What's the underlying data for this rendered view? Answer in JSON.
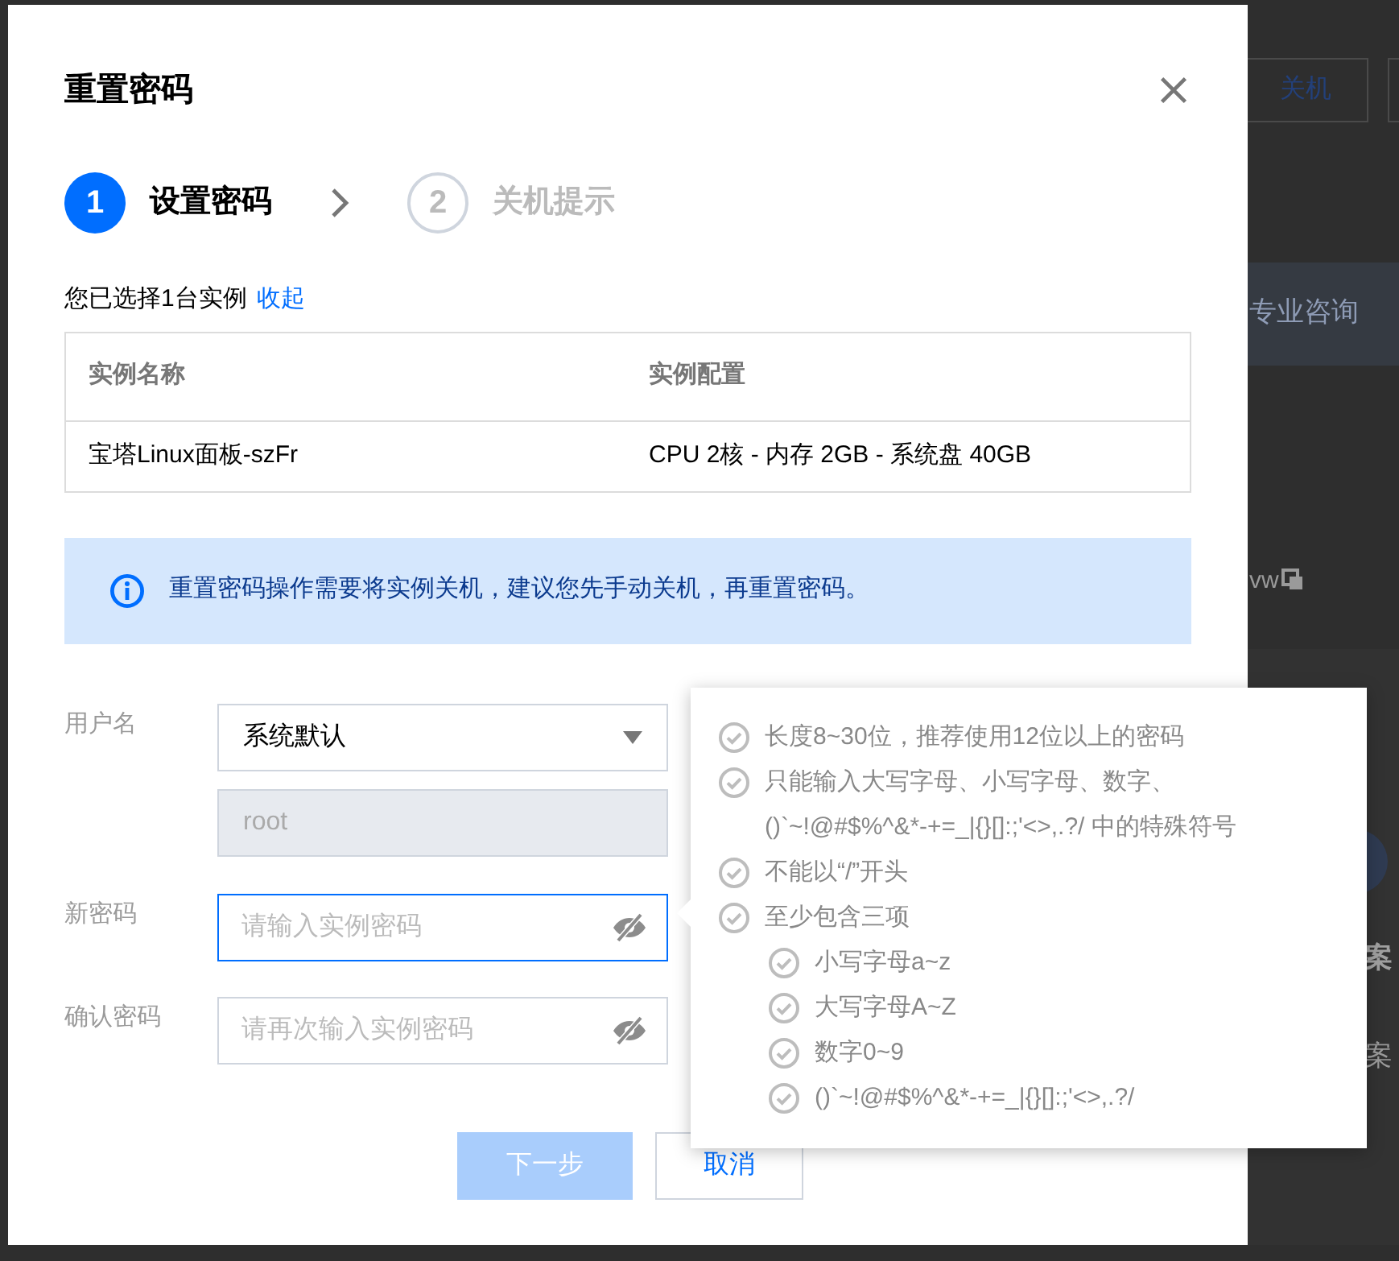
{
  "background": {
    "button": "关机",
    "banner": "专业咨询",
    "copy_text": "vw",
    "card_title": "案",
    "card_text": "案"
  },
  "dialog": {
    "title": "重置密码",
    "steps": [
      {
        "number": "1",
        "label": "设置密码",
        "selected": true
      },
      {
        "number": "2",
        "label": "关机提示",
        "selected": false
      }
    ],
    "selection_note": "您已选择1台实例",
    "collapse_link": "收起",
    "table": {
      "columns": [
        "实例名称",
        "实例配置"
      ],
      "rows": [
        [
          "宝塔Linux面板-szFr",
          "CPU 2核 - 内存 2GB - 系统盘 40GB"
        ]
      ]
    },
    "notice": "重置密码操作需要将实例关机，建议您先手动关机，再重置密码。",
    "form": [
      {
        "label": "用户名",
        "kind": "select",
        "value": "系统默认"
      },
      {
        "kind": "readonly",
        "value": "root"
      },
      {
        "label": "新密码",
        "kind": "password",
        "placeholder": "请输入实例密码",
        "focused": true
      },
      {
        "label": "确认密码",
        "kind": "password",
        "placeholder": "请再次输入实例密码",
        "focused": false
      }
    ],
    "buttons": [
      {
        "label": "下一步",
        "kind": "primary",
        "disabled": true
      },
      {
        "label": "取消",
        "kind": "secondary",
        "disabled": false
      }
    ]
  },
  "password_rules": [
    {
      "text": "长度8~30位，推荐使用12位以上的密码"
    },
    {
      "text": "只能输入大写字母、小写字母、数字、()`~!@#$%^&*-+=_|{}[]:;'<>,.?/ 中的特殊符号"
    },
    {
      "text": "不能以“/”开头"
    },
    {
      "text": "至少包含三项",
      "children": [
        {
          "text": "小写字母a~z"
        },
        {
          "text": "大写字母A~Z"
        },
        {
          "text": "数字0~9"
        },
        {
          "text": "()`~!@#$%^&*-+=_|{}[]:;'<>,.?/"
        }
      ]
    }
  ]
}
